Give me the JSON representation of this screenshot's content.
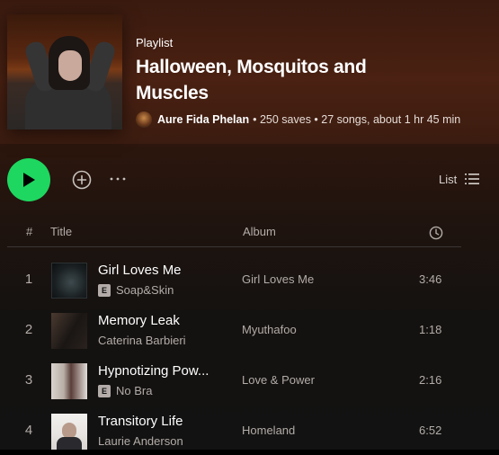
{
  "playlist": {
    "type_label": "Playlist",
    "title": "Halloween, Mosquitos and Muscles",
    "owner": "Aure Fida Phelan",
    "stats": "• 250 saves • 27 songs, about 1 hr 45 min"
  },
  "controls": {
    "view_label": "List"
  },
  "columns": {
    "number": "#",
    "title": "Title",
    "album": "Album"
  },
  "colors": {
    "accent": "#1ed760",
    "header_bg": "#4a2112",
    "text_secondary": "#b3aca8"
  },
  "tracks": [
    {
      "number": "1",
      "title": "Girl Loves Me",
      "artist": "Soap&Skin",
      "explicit": true,
      "explicit_label": "E",
      "album": "Girl Loves Me",
      "duration": "3:46"
    },
    {
      "number": "2",
      "title": "Memory Leak",
      "artist": "Caterina Barbieri",
      "explicit": false,
      "explicit_label": "",
      "album": "Myuthafoo",
      "duration": "1:18"
    },
    {
      "number": "3",
      "title": "Hypnotizing Pow...",
      "artist": "No Bra",
      "explicit": true,
      "explicit_label": "E",
      "album": "Love & Power",
      "duration": "2:16"
    },
    {
      "number": "4",
      "title": "Transitory Life",
      "artist": "Laurie Anderson",
      "explicit": false,
      "explicit_label": "",
      "album": "Homeland",
      "duration": "6:52"
    }
  ]
}
